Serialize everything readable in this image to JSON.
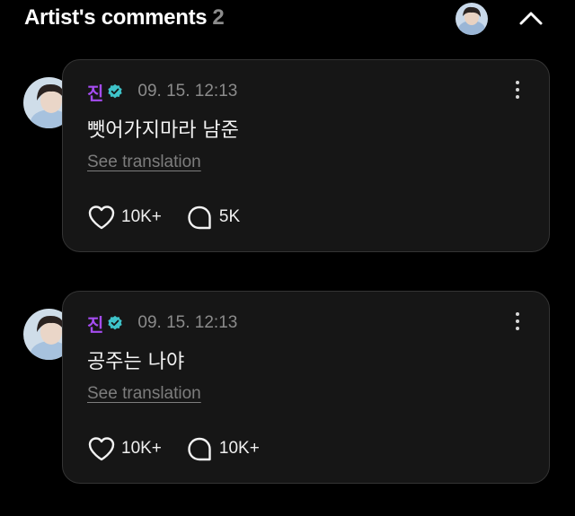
{
  "header": {
    "title": "Artist's comments",
    "count": "2"
  },
  "comments": [
    {
      "artist_name": "진",
      "timestamp": "09. 15. 12:13",
      "text": "뺏어가지마라 남준",
      "see_translation": "See translation",
      "likes": "10K+",
      "replies": "5K"
    },
    {
      "artist_name": "진",
      "timestamp": "09. 15. 12:13",
      "text": "공주는 나야",
      "see_translation": "See translation",
      "likes": "10K+",
      "replies": "10K+"
    }
  ],
  "colors": {
    "background": "#000000",
    "card": "#161616",
    "artist_name": "#a54cf0",
    "verified_badge": "#3ec3c9",
    "muted_text": "#8b8b8b"
  },
  "icons": [
    "avatar",
    "chevron-up-icon",
    "verified-badge-icon",
    "more-vertical-icon",
    "heart-icon",
    "comment-bubble-icon"
  ]
}
